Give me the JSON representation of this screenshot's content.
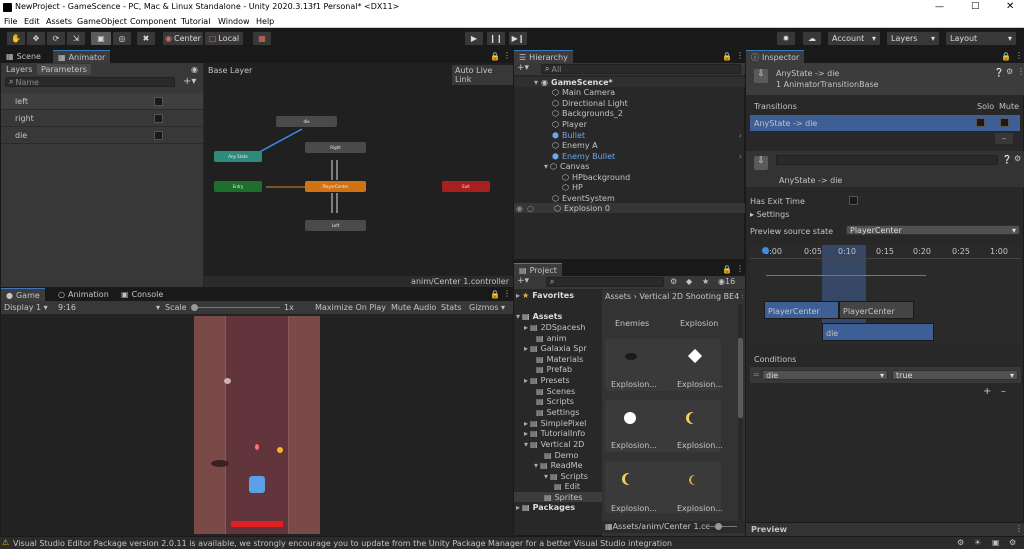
{
  "window": {
    "title": "NewProject - GameScence - PC, Mac & Linux Standalone - Unity 2020.3.13f1 Personal* <DX11>"
  },
  "menu": [
    "File",
    "Edit",
    "Assets",
    "GameObject",
    "Component",
    "Tutorial",
    "Window",
    "Help"
  ],
  "toolbar": {
    "center": "Center",
    "local": "Local",
    "account": "Account",
    "layers": "Layers",
    "layout": "Layout"
  },
  "scene_animator": {
    "tab_scene": "Scene",
    "tab_animator": "Animator",
    "tab_layers": "Layers",
    "tab_parameters": "Parameters",
    "search_placeholder": "Name",
    "base_layer": "Base Layer",
    "auto_live_link": "Auto Live Link",
    "params": [
      {
        "name": "left"
      },
      {
        "name": "right"
      },
      {
        "name": "die"
      }
    ],
    "footer_path": "anim/Center 1.controller",
    "nodes": {
      "die": "die",
      "right": "Right",
      "any_state": "Any State",
      "entry": "Entry",
      "player_center": "PlayerCenter",
      "exit": "Exit",
      "left": "Left"
    },
    "colors": {
      "any_state": "#2f8a7b",
      "entry": "#1e6e2e",
      "default": "#d17215",
      "exit": "#a81f1f",
      "state": "#4a4a4a"
    }
  },
  "game": {
    "tab_game": "Game",
    "tab_animation": "Animation",
    "tab_console": "Console",
    "display": "Display 1",
    "aspect": "9:16",
    "scale_label": "Scale",
    "scale_value": "1x",
    "maximize": "Maximize On Play",
    "mute": "Mute Audio",
    "stats": "Stats",
    "gizmos": "Gizmos"
  },
  "hierarchy": {
    "tab": "Hierarchy",
    "search_placeholder": "All",
    "items": [
      {
        "label": "GameScence*",
        "color": "#ddd"
      },
      {
        "label": "Main Camera",
        "color": "#c4c4c4"
      },
      {
        "label": "Directional Light",
        "color": "#c4c4c4"
      },
      {
        "label": "Backgrounds_2",
        "color": "#c4c4c4"
      },
      {
        "label": "Player",
        "color": "#c4c4c4"
      },
      {
        "label": "Bullet",
        "color": "#6ca7ea"
      },
      {
        "label": "Enemy A",
        "color": "#c4c4c4"
      },
      {
        "label": "Enemy Bullet",
        "color": "#6ca7ea"
      },
      {
        "label": "Canvas",
        "color": "#c4c4c4"
      },
      {
        "label": "HPbackground",
        "color": "#c4c4c4"
      },
      {
        "label": "HP",
        "color": "#c4c4c4"
      },
      {
        "label": "EventSystem",
        "color": "#c4c4c4"
      },
      {
        "label": "Explosion 0",
        "color": "#c4c4c4"
      }
    ]
  },
  "project": {
    "tab": "Project",
    "hidden_count": "16",
    "favorites": "Favorites",
    "assets": "Assets",
    "packages": "Packages",
    "tree": [
      "2DSpacesh",
      "anim",
      "Galaxia Spr",
      "Materials",
      "Prefab",
      "Presets",
      "Scenes",
      "Scripts",
      "Settings",
      "SimplePixel",
      "TutorialInfo",
      "Vertical 2D",
      "Demo",
      "ReadMe",
      "Scripts",
      "Edit",
      "Sprites"
    ],
    "breadcrumb": [
      "Assets",
      "Vertical 2D Shooting BE4",
      "S"
    ],
    "grid_labels": [
      "Enemies",
      "Explosion",
      "Explosion...",
      "Explosion...",
      "Explosion...",
      "Explosion...",
      "Explosion...",
      "Explosion..."
    ],
    "footer_path": "Assets/anim/Center 1.cc"
  },
  "inspector": {
    "tab": "Inspector",
    "title": "AnyState -> die",
    "subtitle": "1 AnimatorTransitionBase",
    "transitions_label": "Transitions",
    "solo": "Solo",
    "mute": "Mute",
    "transition_item": "AnyState -> die",
    "name_caption": "AnyState -> die",
    "has_exit_time": "Has Exit Time",
    "settings": "Settings",
    "preview_source_label": "Preview source state",
    "preview_source_value": "PlayerCenter",
    "timeline_ticks": [
      "0:00",
      "0:05",
      "0:10",
      "0:15",
      "0:20",
      "0:25",
      "1:00"
    ],
    "timeline_bar1": "PlayerCenter",
    "timeline_bar2": "PlayerCenter",
    "timeline_bar3": "die",
    "conditions": "Conditions",
    "condition_param": "die",
    "condition_value": "true",
    "preview": "Preview"
  },
  "status": {
    "message": "Visual Studio Editor Package version 2.0.11 is available, we strongly encourage you to update from the Unity Package Manager for a better Visual Studio integration"
  }
}
